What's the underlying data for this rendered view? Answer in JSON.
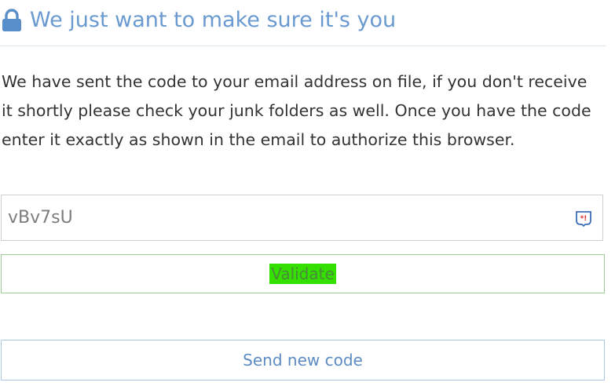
{
  "header": {
    "title": "We just want to make sure it's you",
    "icon": "lock-icon"
  },
  "message": {
    "text": "We have sent the code to your email address on file, if you don't receive it shortly please check your junk folders as well. Once you have the code enter it exactly as shown in the email to authorize this browser."
  },
  "code_field": {
    "value": "vBv7sU",
    "icon": "password-manager-icon"
  },
  "buttons": {
    "validate_label": "Validate",
    "send_new_code_label": "Send new code"
  },
  "colors": {
    "accent_blue": "#6a9ad0",
    "validate_highlight": "#33e000",
    "validate_border": "#9ccf94",
    "send_border": "#a9c6e6"
  }
}
